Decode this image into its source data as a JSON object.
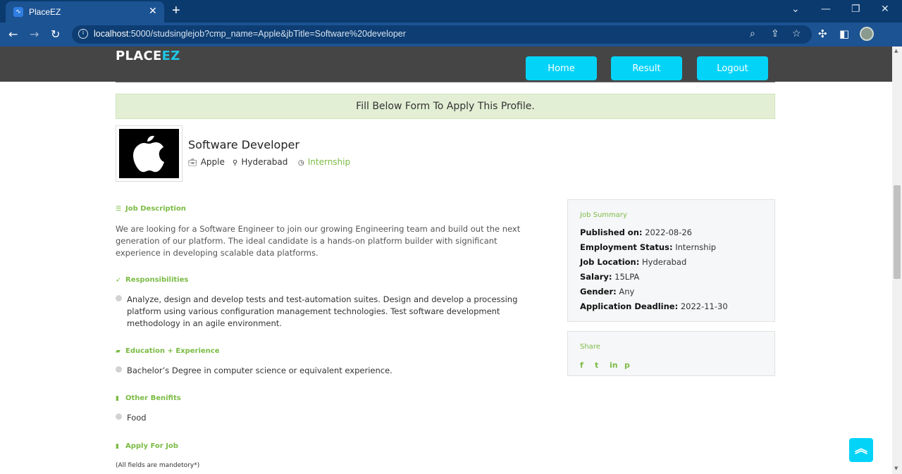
{
  "browser": {
    "tab_title": "PlaceEZ",
    "tab_close": "✕",
    "new_tab": "+",
    "url_host": "localhost",
    "url_rest": ":5000/studsinglejob?cmp_name=Apple&jbTitle=Software%20developer",
    "minimize": "⌄",
    "restore": "—",
    "maximize": "❐",
    "close": "✕",
    "back": "←",
    "forward": "→",
    "reload": "↻"
  },
  "header": {
    "logo_main": "PLACE",
    "logo_accent": "EZ",
    "nav": {
      "home": "Home",
      "result": "Result",
      "logout": "Logout"
    }
  },
  "banner": "Fill Below Form To Apply This Profile.",
  "job": {
    "title": "Software Developer",
    "company": "Apple",
    "location": "Hyderabad",
    "type": "Internship"
  },
  "sections": {
    "description_head": "Job Description",
    "description": "We are looking for a Software Engineer to join our growing Engineering team and build out the next generation of our platform. The ideal candidate is a hands-on platform builder with significant experience in developing scalable data platforms.",
    "responsibilities_head": "Responsibilities",
    "responsibilities": "Analyze, design and develop tests and test-automation suites. Design and develop a processing platform using various configuration management technologies. Test software development methodology in an agile environment.",
    "education_head": "Education + Experience",
    "education": "Bachelor’s Degree in computer science or equivalent experience.",
    "benefits_head": "Other Benifits",
    "benefits": "Food",
    "apply_head": "Apply For Job",
    "apply_note": "(All fields are mandetory*)"
  },
  "summary": {
    "head": "Job Summary",
    "published_label": "Published on:",
    "published_value": "2022-08-26",
    "status_label": "Employment Status:",
    "status_value": "Internship",
    "location_label": "Job Location:",
    "location_value": "Hyderabad",
    "salary_label": "Salary:",
    "salary_value": "15LPA",
    "gender_label": "Gender:",
    "gender_value": "Any",
    "deadline_label": "Application Deadline:",
    "deadline_value": "2022-11-30"
  },
  "share": {
    "head": "Share",
    "facebook": "f",
    "twitter": "t",
    "linkedin": "in",
    "pinterest": "p"
  },
  "icons": {
    "briefcase": "briefcase-icon",
    "pin": "map-pin-icon",
    "clock": "clock-icon",
    "to_top": "chevron-double-up-icon"
  },
  "colors": {
    "accent_green": "#7bbb44",
    "nav_cyan": "#04d3f8",
    "header_bg": "#454545",
    "banner_bg": "#e2efd4"
  }
}
